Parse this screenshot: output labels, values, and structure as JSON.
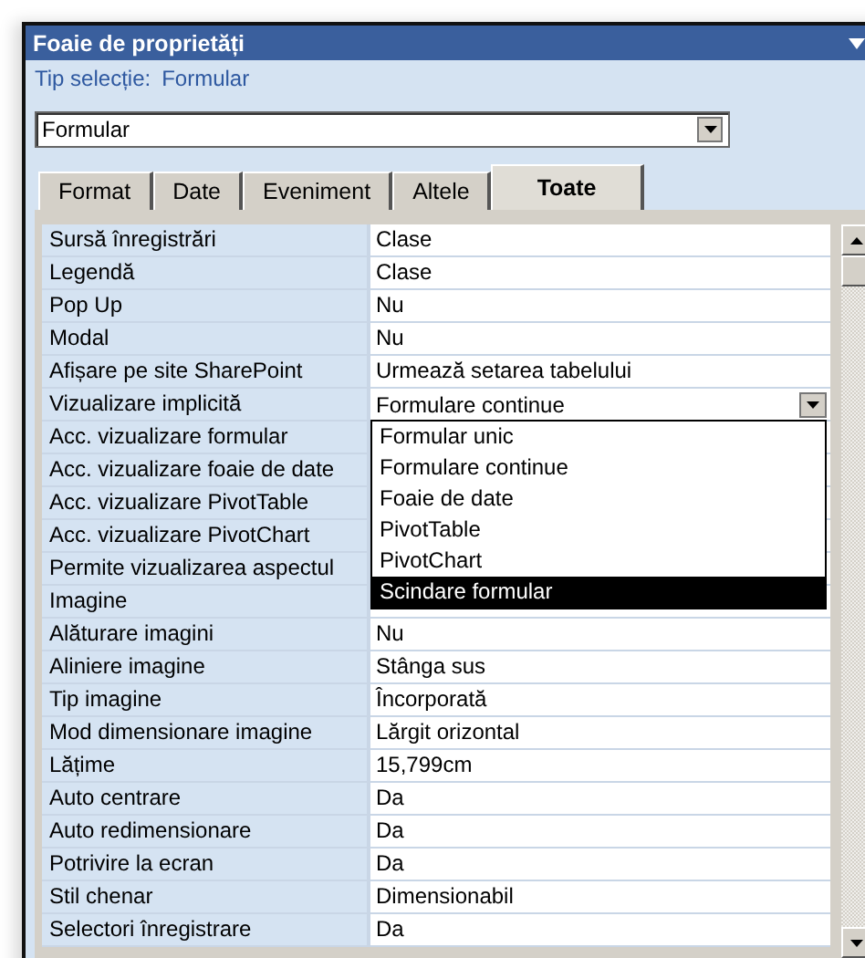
{
  "window": {
    "title": "Foaie de proprietăți"
  },
  "selection": {
    "label": "Tip selecție:",
    "value": "Formular"
  },
  "object_combo": {
    "value": "Formular"
  },
  "tabs": [
    {
      "label": "Format",
      "selected": false
    },
    {
      "label": "Date",
      "selected": false
    },
    {
      "label": "Eveniment",
      "selected": false
    },
    {
      "label": "Altele",
      "selected": false
    },
    {
      "label": "Toate",
      "selected": true
    }
  ],
  "properties": [
    {
      "name": "Sursă înregistrări",
      "kind": "text",
      "value": "Clase"
    },
    {
      "name": "Legendă",
      "kind": "text",
      "value": "Clase"
    },
    {
      "name": "Pop Up",
      "kind": "text",
      "value": "Nu"
    },
    {
      "name": "Modal",
      "kind": "text",
      "value": "Nu"
    },
    {
      "name": "Afișare pe site SharePoint",
      "kind": "text",
      "value": "Urmează setarea tabelului"
    },
    {
      "name": "Vizualizare implicită",
      "kind": "dropdown",
      "value": "Formulare continue"
    },
    {
      "name": "Acc. vizualizare formular",
      "kind": "text"
    },
    {
      "name": "Acc. vizualizare foaie de date",
      "kind": "text"
    },
    {
      "name": "Acc. vizualizare PivotTable",
      "kind": "text"
    },
    {
      "name": "Acc. vizualizare PivotChart",
      "kind": "text"
    },
    {
      "name": "Permite vizualizarea aspectul",
      "kind": "text"
    },
    {
      "name": "Imagine",
      "kind": "text"
    },
    {
      "name": "Alăturare imagini",
      "kind": "text",
      "value": "Nu"
    },
    {
      "name": "Aliniere imagine",
      "kind": "text",
      "value": "Stânga sus"
    },
    {
      "name": "Tip imagine",
      "kind": "text",
      "value": "Încorporată"
    },
    {
      "name": "Mod dimensionare imagine",
      "kind": "text",
      "value": "Lărgit orizontal"
    },
    {
      "name": "Lățime",
      "kind": "text",
      "value": "15,799cm"
    },
    {
      "name": "Auto centrare",
      "kind": "text",
      "value": "Da"
    },
    {
      "name": "Auto redimensionare",
      "kind": "text",
      "value": "Da"
    },
    {
      "name": "Potrivire la ecran",
      "kind": "text",
      "value": "Da"
    },
    {
      "name": "Stil chenar",
      "kind": "text",
      "value": "Dimensionabil"
    },
    {
      "name": "Selectori înregistrare",
      "kind": "text",
      "value": "Da"
    }
  ],
  "dropdown_options": [
    {
      "label": "Formular unic",
      "selected": false
    },
    {
      "label": "Formulare continue",
      "selected": false
    },
    {
      "label": "Foaie de date",
      "selected": false
    },
    {
      "label": "PivotTable",
      "selected": false
    },
    {
      "label": "PivotChart",
      "selected": false
    },
    {
      "label": "Scindare formular",
      "selected": true
    }
  ]
}
